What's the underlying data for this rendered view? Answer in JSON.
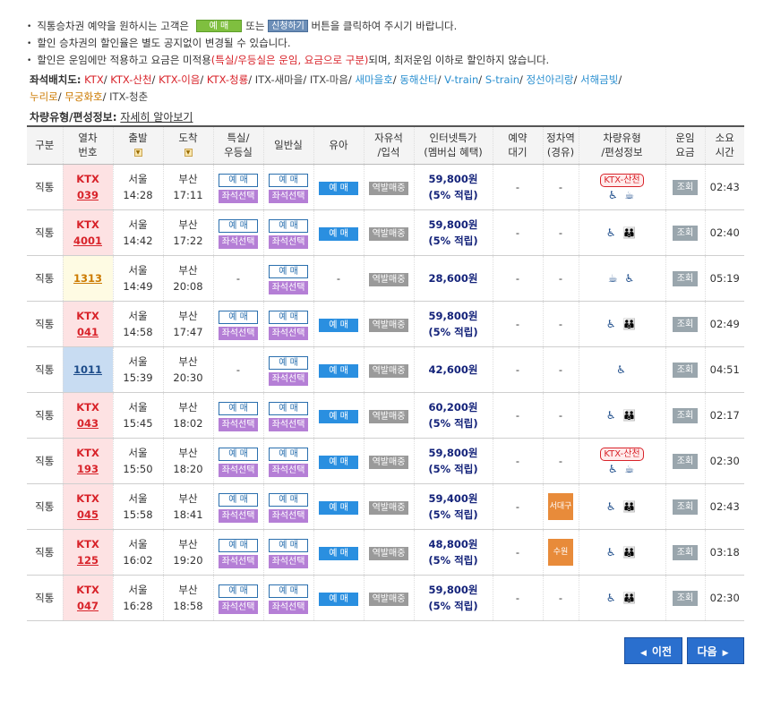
{
  "notes": [
    {
      "pre": "직통승차권 예약을 원하시는 고객은",
      "btn1": "예 매",
      "mid": "또는",
      "btn2": "신청하기",
      "post": "버튼을 클릭하여 주시기 바랍니다."
    },
    {
      "text": "할인 승차권의 할인율은 별도 공지없이 변경될 수 있습니다."
    },
    {
      "pre": "할인은 운임에만 적용하고 요금은 미적용",
      "red": "(특실/우등실은 운임, 요금으로 구분)",
      "post": "되며, 최저운임 이하로 할인하지 않습니다."
    }
  ],
  "seat_layout": {
    "label": "좌석배치도:",
    "links": [
      {
        "text": "KTX",
        "color": "red"
      },
      {
        "text": "KTX-산천",
        "color": "red"
      },
      {
        "text": "KTX-이음",
        "color": "red"
      },
      {
        "text": "KTX-청룡",
        "color": "red"
      },
      {
        "text": "ITX-새마을",
        "color": "gray"
      },
      {
        "text": "ITX-마음",
        "color": "gray"
      },
      {
        "text": "새마을호",
        "color": "blue"
      },
      {
        "text": "동해산타",
        "color": "blue"
      },
      {
        "text": "V-train",
        "color": "blue"
      },
      {
        "text": "S-train",
        "color": "blue"
      },
      {
        "text": "정선아리랑",
        "color": "blue"
      },
      {
        "text": "서해금빛",
        "color": "blue"
      },
      {
        "text": "누리로",
        "color": "orange"
      },
      {
        "text": "무궁화호",
        "color": "orange"
      },
      {
        "text": "ITX-청춘",
        "color": "gray"
      }
    ]
  },
  "vehicle_info": {
    "label": "차량유형/편성정보:",
    "link": "자세히 알아보기"
  },
  "headers": [
    "구분",
    "열차\n번호",
    "출발",
    "도착",
    "특실/\n우등실",
    "일반실",
    "유아",
    "자유석\n/입석",
    "인터넷특가\n(멤버십 혜택)",
    "예약\n대기",
    "정차역\n(경유)",
    "차량유형\n/편성정보",
    "운임\n요금",
    "소요\n시간"
  ],
  "buttons": {
    "reserve": "예 매",
    "seat_select": "좌석선택",
    "station_sale": "역발매중",
    "fare": "조회"
  },
  "rows": [
    {
      "type": "직통",
      "cls": "ktx",
      "brand": "KTX",
      "no": "039",
      "from": "서울",
      "dep": "14:28",
      "to": "부산",
      "arr": "17:11",
      "special": true,
      "general": true,
      "infant": "btn",
      "price": "59,800원",
      "reward": "(5% 적립)",
      "wait": "-",
      "stop": "-",
      "vehicle": "ktxs",
      "vehicle_label": "KTX-산천",
      "icons": "♿ ☕",
      "time": "02:43"
    },
    {
      "type": "직통",
      "cls": "ktx",
      "brand": "KTX",
      "no": "4001",
      "from": "서울",
      "dep": "14:42",
      "to": "부산",
      "arr": "17:22",
      "special": true,
      "general": true,
      "infant": "btn",
      "price": "59,800원",
      "reward": "(5% 적립)",
      "wait": "-",
      "stop": "-",
      "vehicle": "icons",
      "vehicle_label": "",
      "icons": "♿ 👪",
      "time": "02:40"
    },
    {
      "type": "직통",
      "cls": "mugung",
      "brand": "",
      "no": "1313",
      "from": "서울",
      "dep": "14:49",
      "to": "부산",
      "arr": "20:08",
      "special": false,
      "general": true,
      "infant": "-",
      "price": "28,600원",
      "reward": "",
      "wait": "-",
      "stop": "-",
      "vehicle": "icons",
      "vehicle_label": "",
      "icons": "☕ ♿",
      "time": "05:19"
    },
    {
      "type": "직통",
      "cls": "ktx",
      "brand": "KTX",
      "no": "041",
      "from": "서울",
      "dep": "14:58",
      "to": "부산",
      "arr": "17:47",
      "special": true,
      "general": true,
      "infant": "btn",
      "price": "59,800원",
      "reward": "(5% 적립)",
      "wait": "-",
      "stop": "-",
      "vehicle": "icons",
      "vehicle_label": "",
      "icons": "♿ 👪",
      "time": "02:49"
    },
    {
      "type": "직통",
      "cls": "itx",
      "brand": "",
      "no": "1011",
      "from": "서울",
      "dep": "15:39",
      "to": "부산",
      "arr": "20:30",
      "special": false,
      "general": true,
      "infant": "btn",
      "price": "42,600원",
      "reward": "",
      "wait": "-",
      "stop": "-",
      "vehicle": "icons",
      "vehicle_label": "",
      "icons": "♿",
      "time": "04:51"
    },
    {
      "type": "직통",
      "cls": "ktx",
      "brand": "KTX",
      "no": "043",
      "from": "서울",
      "dep": "15:45",
      "to": "부산",
      "arr": "18:02",
      "special": true,
      "general": true,
      "infant": "btn",
      "price": "60,200원",
      "reward": "(5% 적립)",
      "wait": "-",
      "stop": "-",
      "vehicle": "icons",
      "vehicle_label": "",
      "icons": "♿ 👪",
      "time": "02:17"
    },
    {
      "type": "직통",
      "cls": "ktx",
      "brand": "KTX",
      "no": "193",
      "from": "서울",
      "dep": "15:50",
      "to": "부산",
      "arr": "18:20",
      "special": true,
      "general": true,
      "infant": "btn",
      "price": "59,800원",
      "reward": "(5% 적립)",
      "wait": "-",
      "stop": "-",
      "vehicle": "ktxs",
      "vehicle_label": "KTX-산천",
      "icons": "♿ ☕",
      "time": "02:30"
    },
    {
      "type": "직통",
      "cls": "ktx",
      "brand": "KTX",
      "no": "045",
      "from": "서울",
      "dep": "15:58",
      "to": "부산",
      "arr": "18:41",
      "special": true,
      "general": true,
      "infant": "btn",
      "price": "59,400원",
      "reward": "(5% 적립)",
      "wait": "-",
      "stop": "서대구",
      "vehicle": "icons",
      "vehicle_label": "",
      "icons": "♿ 👪",
      "time": "02:43"
    },
    {
      "type": "직통",
      "cls": "ktx",
      "brand": "KTX",
      "no": "125",
      "from": "서울",
      "dep": "16:02",
      "to": "부산",
      "arr": "19:20",
      "special": true,
      "general": true,
      "infant": "btn",
      "price": "48,800원",
      "reward": "(5% 적립)",
      "wait": "-",
      "stop": "수원",
      "vehicle": "icons",
      "vehicle_label": "",
      "icons": "♿ 👪",
      "time": "03:18"
    },
    {
      "type": "직통",
      "cls": "ktx",
      "brand": "KTX",
      "no": "047",
      "from": "서울",
      "dep": "16:28",
      "to": "부산",
      "arr": "18:58",
      "special": true,
      "general": true,
      "infant": "btn",
      "price": "59,800원",
      "reward": "(5% 적립)",
      "wait": "-",
      "stop": "-",
      "vehicle": "icons",
      "vehicle_label": "",
      "icons": "♿ 👪",
      "time": "02:30"
    }
  ],
  "pagination": {
    "prev": "이전",
    "next": "다음"
  }
}
